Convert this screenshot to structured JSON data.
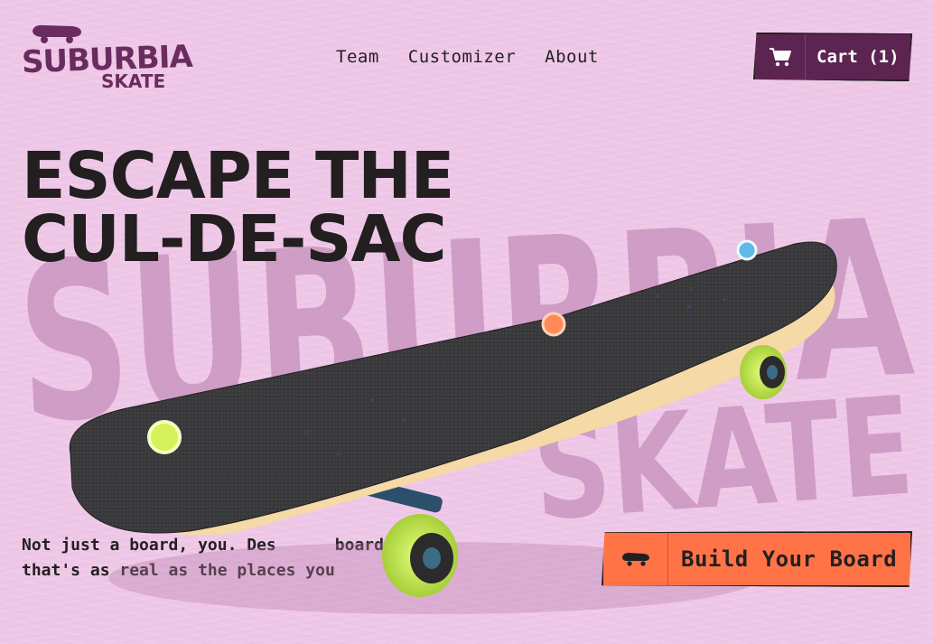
{
  "brand": {
    "name_line1": "SUBURBIA",
    "name_line2": "SKATE"
  },
  "nav": {
    "items": [
      {
        "label": "Team"
      },
      {
        "label": "Customizer"
      },
      {
        "label": "About"
      }
    ]
  },
  "cart": {
    "label": "Cart (1)",
    "icon": "cart-icon",
    "color": "#5c2450"
  },
  "hero": {
    "title_line1": "ESCAPE THE",
    "title_line2": "CUL-DE-SAC",
    "watermark_line1": "SUBURBIA",
    "watermark_line2": "SKATE",
    "tagline_line1": "Not just a board, you",
    "tagline_part_b": ". Des",
    "tagline_part_c": "board",
    "tagline_line2": "that's as real as the places you",
    "tagline_end": "."
  },
  "hotspots": [
    {
      "name": "hotspot-nose",
      "color": "#5fb8e6"
    },
    {
      "name": "hotspot-middle",
      "color": "#ff8a55"
    },
    {
      "name": "hotspot-tail",
      "color": "#d6f25a"
    }
  ],
  "cta": {
    "label": "Build Your Board",
    "icon": "skateboard-icon",
    "color": "#ff7347"
  },
  "colors": {
    "background": "#efc8e8",
    "brand": "#6a2c5e",
    "ink": "#231f20",
    "accent": "#ff7347"
  }
}
